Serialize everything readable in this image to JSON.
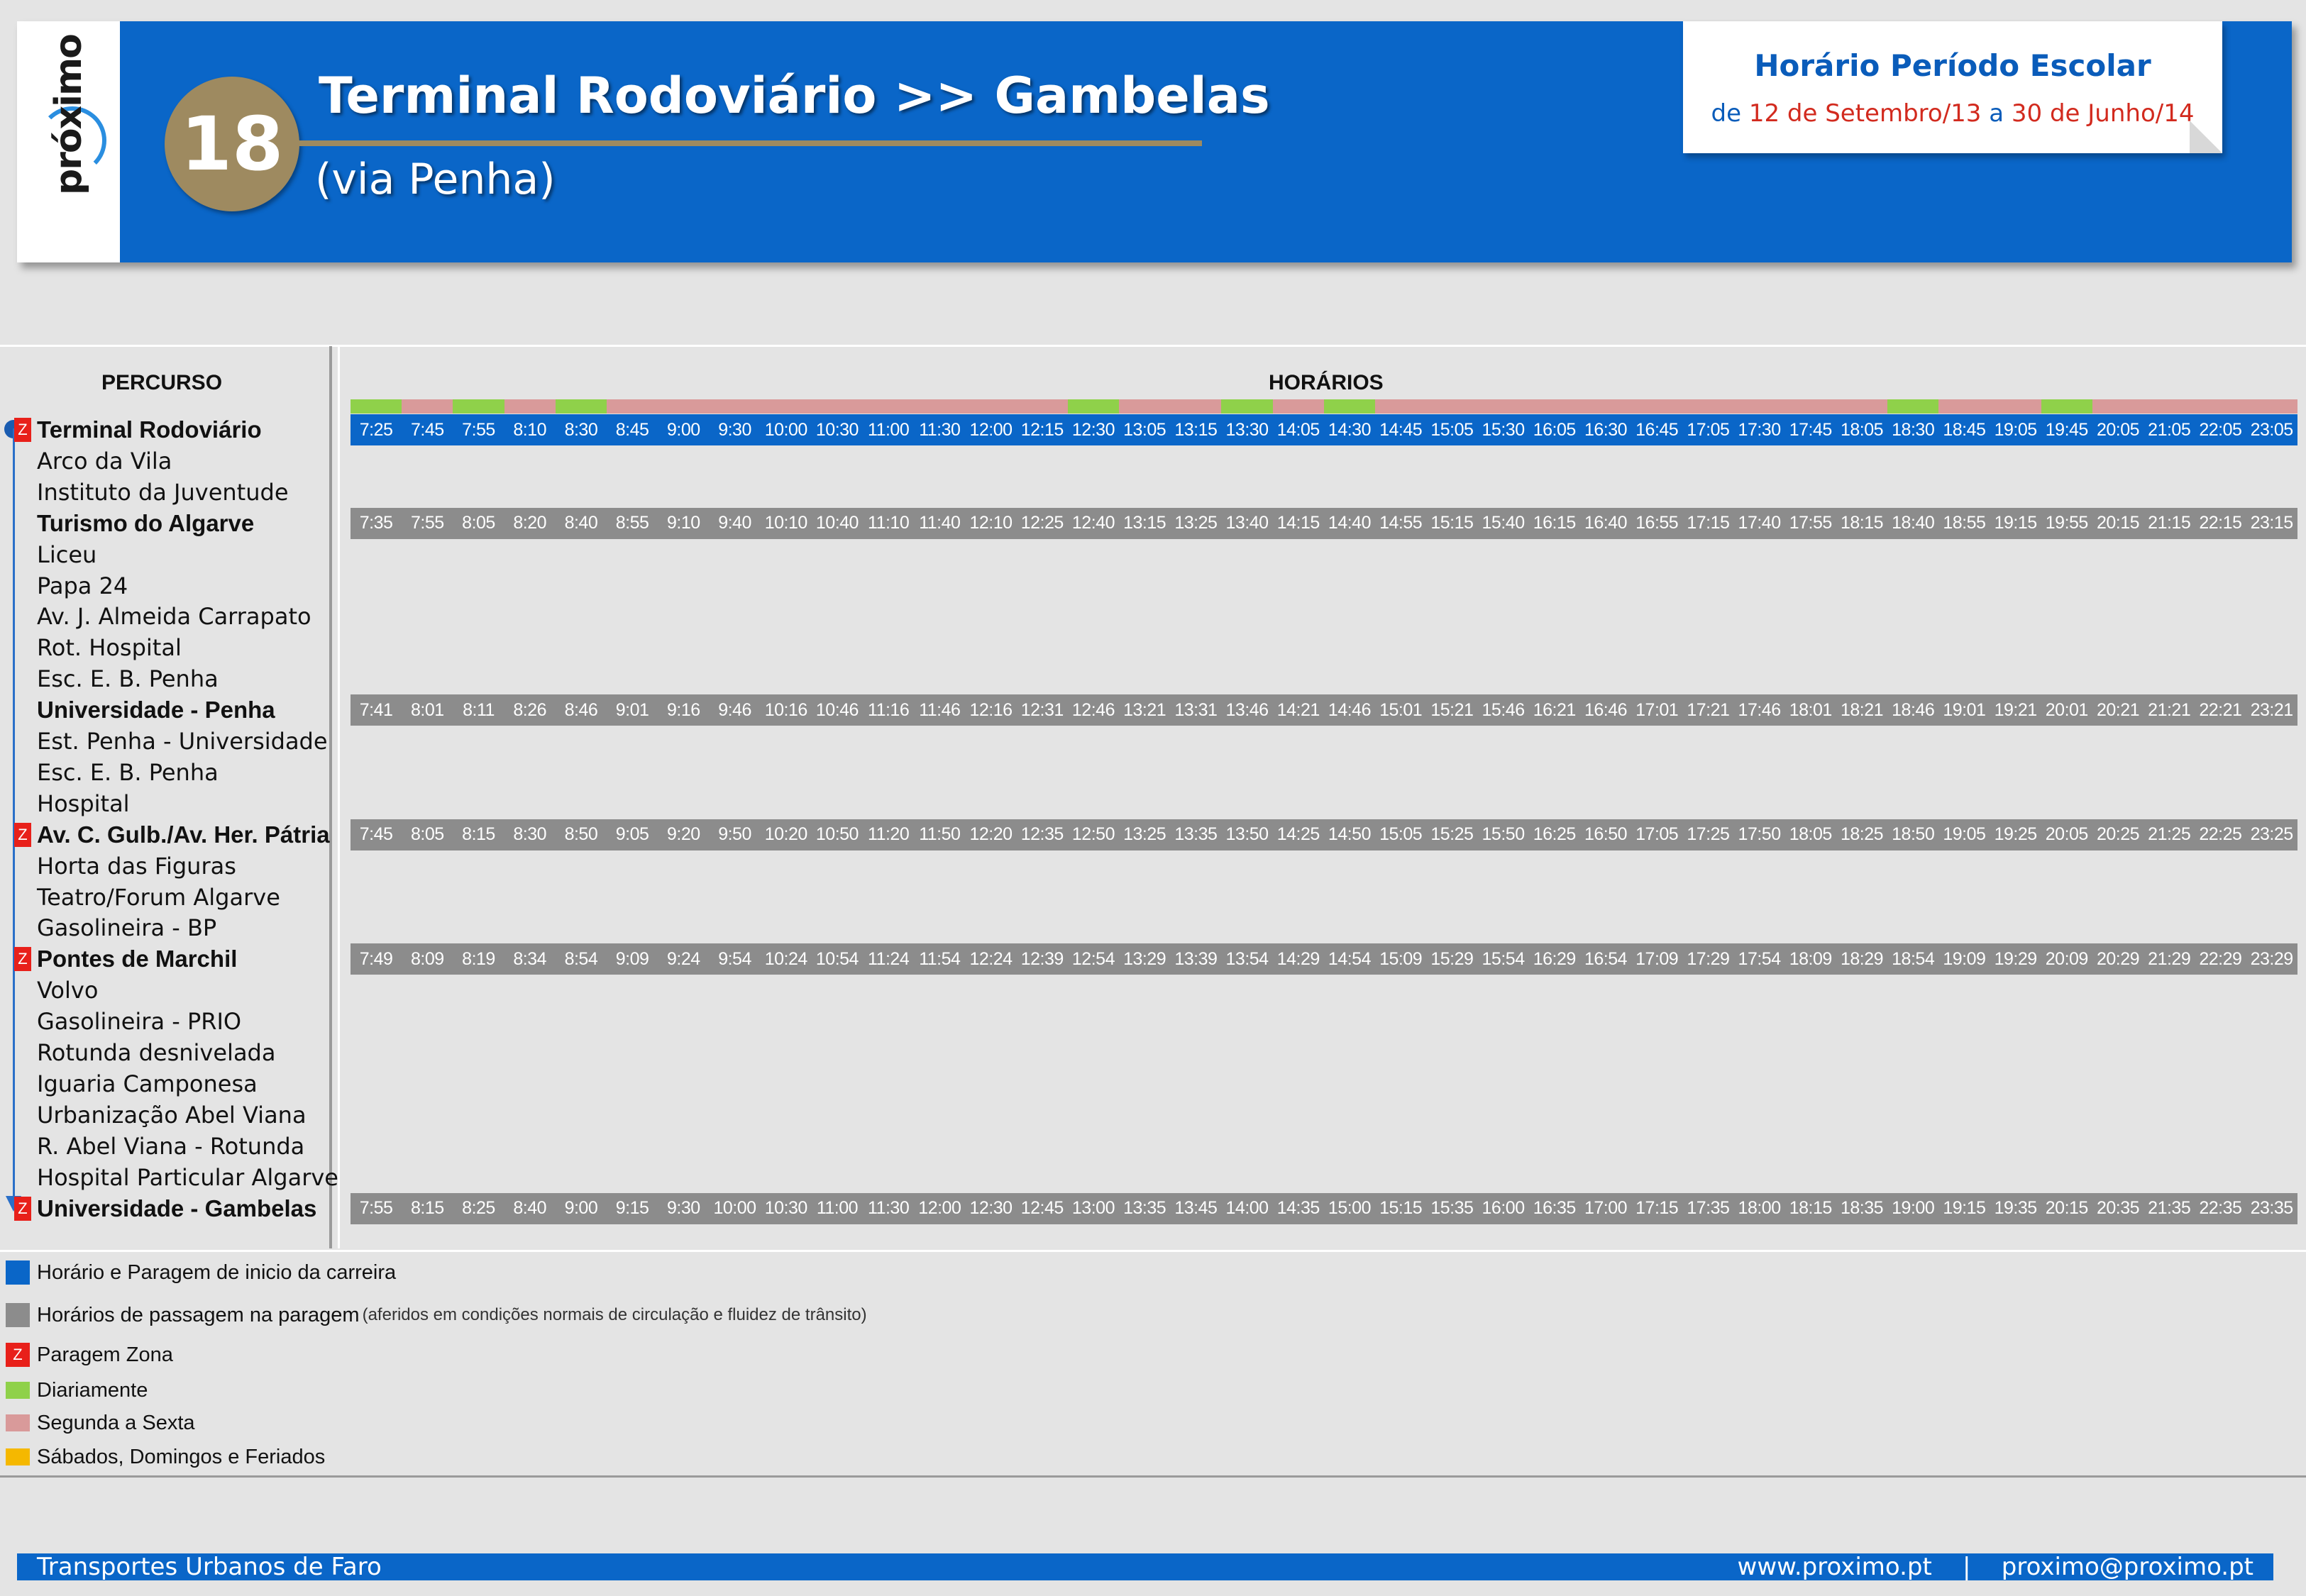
{
  "header": {
    "logo": "próximo",
    "route_number": "18",
    "route_title": "Terminal Rodoviário >> Gambelas",
    "route_subtitle": "(via Penha)",
    "period_title": "Horário Período Escolar",
    "period_de": "de",
    "period_start": "12 de Setembro/13",
    "period_a": "a",
    "period_end": "30 de Junho/14"
  },
  "columns": {
    "percurso": "PERCURSO",
    "horarios": "HORÁRIOS"
  },
  "colors": {
    "blue": "#0a66c8",
    "gray": "#8c8c8c",
    "zone_red": "#e8201a",
    "daily_green": "#8fd14a",
    "weekday_pink": "#d99a9a",
    "weekend_yellow": "#f5b800"
  },
  "day_types": [
    "daily",
    "weekday",
    "daily",
    "weekday",
    "daily",
    "weekday",
    "weekday",
    "weekday",
    "weekday",
    "weekday",
    "weekday",
    "weekday",
    "weekday",
    "weekday",
    "daily",
    "weekday",
    "weekday",
    "daily",
    "weekday",
    "daily",
    "weekday",
    "weekday",
    "weekday",
    "weekday",
    "weekday",
    "weekday",
    "weekday",
    "weekday",
    "weekday",
    "weekday",
    "daily",
    "weekday",
    "weekday",
    "daily",
    "weekday",
    "weekday",
    "weekday",
    "weekday"
  ],
  "stops": [
    {
      "name": "Terminal Rodoviário",
      "main": true,
      "zone": true
    },
    {
      "name": "Arco da Vila",
      "main": false,
      "zone": false
    },
    {
      "name": "Instituto da Juventude",
      "main": false,
      "zone": false
    },
    {
      "name": "Turismo do Algarve",
      "main": true,
      "zone": false
    },
    {
      "name": "Liceu",
      "main": false,
      "zone": false
    },
    {
      "name": "Papa 24",
      "main": false,
      "zone": false
    },
    {
      "name": "Av. J. Almeida Carrapato",
      "main": false,
      "zone": false
    },
    {
      "name": "Rot. Hospital",
      "main": false,
      "zone": false
    },
    {
      "name": "Esc. E. B. Penha",
      "main": false,
      "zone": false
    },
    {
      "name": "Universidade - Penha",
      "main": true,
      "zone": false
    },
    {
      "name": "Est. Penha - Universidade",
      "main": false,
      "zone": false
    },
    {
      "name": "Esc. E. B. Penha",
      "main": false,
      "zone": false
    },
    {
      "name": "Hospital",
      "main": false,
      "zone": false
    },
    {
      "name": "Av. C. Gulb./Av. Her. Pátria",
      "main": true,
      "zone": true
    },
    {
      "name": "Horta das Figuras",
      "main": false,
      "zone": false
    },
    {
      "name": "Teatro/Forum Algarve",
      "main": false,
      "zone": false
    },
    {
      "name": "Gasolineira - BP",
      "main": false,
      "zone": false
    },
    {
      "name": "Pontes de Marchil",
      "main": true,
      "zone": true
    },
    {
      "name": "Volvo",
      "main": false,
      "zone": false
    },
    {
      "name": "Gasolineira - PRIO",
      "main": false,
      "zone": false
    },
    {
      "name": "Rotunda desnivelada",
      "main": false,
      "zone": false
    },
    {
      "name": "Iguaria Camponesa",
      "main": false,
      "zone": false
    },
    {
      "name": "Urbanização Abel Viana",
      "main": false,
      "zone": false
    },
    {
      "name": "R. Abel Viana - Rotunda",
      "main": false,
      "zone": false
    },
    {
      "name": "Hospital Particular Algarve",
      "main": false,
      "zone": false
    },
    {
      "name": "Universidade - Gambelas",
      "main": true,
      "zone": true
    }
  ],
  "zone_letter": "Z",
  "timetable": [
    {
      "stop_index": 0,
      "style": "blue",
      "times": [
        "7:25",
        "7:45",
        "7:55",
        "8:10",
        "8:30",
        "8:45",
        "9:00",
        "9:30",
        "10:00",
        "10:30",
        "11:00",
        "11:30",
        "12:00",
        "12:15",
        "12:30",
        "13:05",
        "13:15",
        "13:30",
        "14:05",
        "14:30",
        "14:45",
        "15:05",
        "15:30",
        "16:05",
        "16:30",
        "16:45",
        "17:05",
        "17:30",
        "17:45",
        "18:05",
        "18:30",
        "18:45",
        "19:05",
        "19:45",
        "20:05",
        "21:05",
        "22:05",
        "23:05"
      ]
    },
    {
      "stop_index": 3,
      "style": "gray",
      "times": [
        "7:35",
        "7:55",
        "8:05",
        "8:20",
        "8:40",
        "8:55",
        "9:10",
        "9:40",
        "10:10",
        "10:40",
        "11:10",
        "11:40",
        "12:10",
        "12:25",
        "12:40",
        "13:15",
        "13:25",
        "13:40",
        "14:15",
        "14:40",
        "14:55",
        "15:15",
        "15:40",
        "16:15",
        "16:40",
        "16:55",
        "17:15",
        "17:40",
        "17:55",
        "18:15",
        "18:40",
        "18:55",
        "19:15",
        "19:55",
        "20:15",
        "21:15",
        "22:15",
        "23:15"
      ]
    },
    {
      "stop_index": 9,
      "style": "gray",
      "times": [
        "7:41",
        "8:01",
        "8:11",
        "8:26",
        "8:46",
        "9:01",
        "9:16",
        "9:46",
        "10:16",
        "10:46",
        "11:16",
        "11:46",
        "12:16",
        "12:31",
        "12:46",
        "13:21",
        "13:31",
        "13:46",
        "14:21",
        "14:46",
        "15:01",
        "15:21",
        "15:46",
        "16:21",
        "16:46",
        "17:01",
        "17:21",
        "17:46",
        "18:01",
        "18:21",
        "18:46",
        "19:01",
        "19:21",
        "20:01",
        "20:21",
        "21:21",
        "22:21",
        "23:21"
      ]
    },
    {
      "stop_index": 13,
      "style": "gray",
      "times": [
        "7:45",
        "8:05",
        "8:15",
        "8:30",
        "8:50",
        "9:05",
        "9:20",
        "9:50",
        "10:20",
        "10:50",
        "11:20",
        "11:50",
        "12:20",
        "12:35",
        "12:50",
        "13:25",
        "13:35",
        "13:50",
        "14:25",
        "14:50",
        "15:05",
        "15:25",
        "15:50",
        "16:25",
        "16:50",
        "17:05",
        "17:25",
        "17:50",
        "18:05",
        "18:25",
        "18:50",
        "19:05",
        "19:25",
        "20:05",
        "20:25",
        "21:25",
        "22:25",
        "23:25"
      ]
    },
    {
      "stop_index": 17,
      "style": "gray",
      "times": [
        "7:49",
        "8:09",
        "8:19",
        "8:34",
        "8:54",
        "9:09",
        "9:24",
        "9:54",
        "10:24",
        "10:54",
        "11:24",
        "11:54",
        "12:24",
        "12:39",
        "12:54",
        "13:29",
        "13:39",
        "13:54",
        "14:29",
        "14:54",
        "15:09",
        "15:29",
        "15:54",
        "16:29",
        "16:54",
        "17:09",
        "17:29",
        "17:54",
        "18:09",
        "18:29",
        "18:54",
        "19:09",
        "19:29",
        "20:09",
        "20:29",
        "21:29",
        "22:29",
        "23:29"
      ]
    },
    {
      "stop_index": 25,
      "style": "gray",
      "times": [
        "7:55",
        "8:15",
        "8:25",
        "8:40",
        "9:00",
        "9:15",
        "9:30",
        "10:00",
        "10:30",
        "11:00",
        "11:30",
        "12:00",
        "12:30",
        "12:45",
        "13:00",
        "13:35",
        "13:45",
        "14:00",
        "14:35",
        "15:00",
        "15:15",
        "15:35",
        "16:00",
        "16:35",
        "17:00",
        "17:15",
        "17:35",
        "18:00",
        "18:15",
        "18:35",
        "19:00",
        "19:15",
        "19:35",
        "20:15",
        "20:35",
        "21:35",
        "22:35",
        "23:35"
      ]
    }
  ],
  "legend": {
    "start": "Horário e Paragem de inicio da carreira",
    "passing": "Horários de passagem na paragem",
    "passing_note": "(aferidos em condições normais de circulação e fluidez de trânsito)",
    "zone": "Paragem Zona",
    "daily": "Diariamente",
    "weekday": "Segunda a Sexta",
    "weekend": "Sábados, Domingos e Feriados"
  },
  "footer": {
    "left": "Transportes Urbanos de Faro",
    "website": "www.proximo.pt",
    "separator": "|",
    "email": "proximo@proximo.pt"
  }
}
